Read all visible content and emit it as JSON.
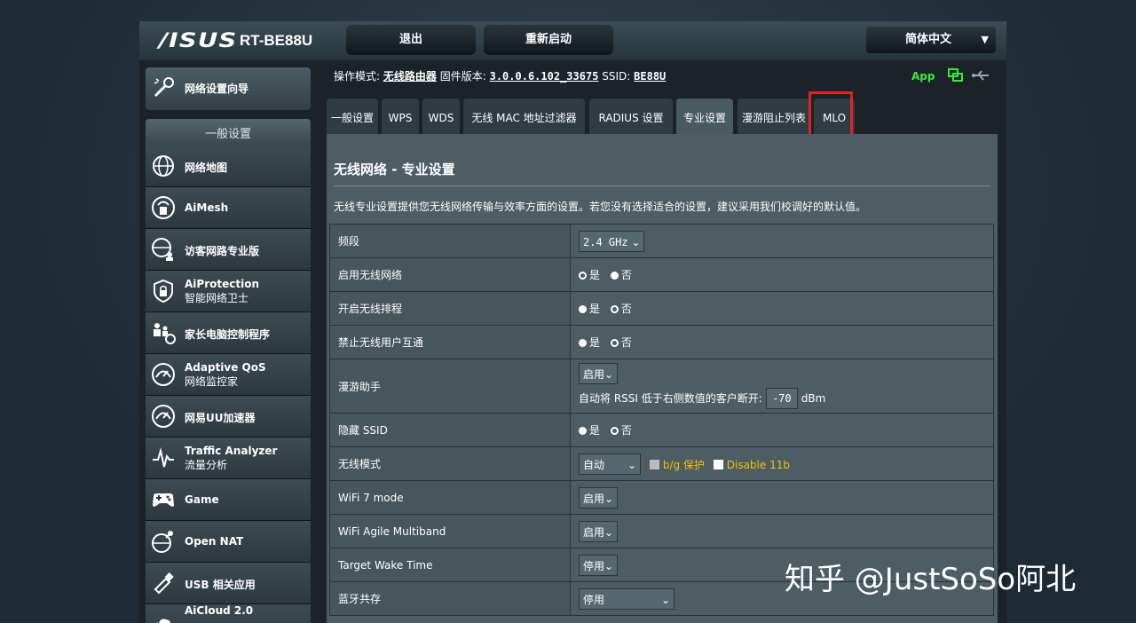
{
  "header": {
    "logo": "/ISUS",
    "model": "RT-BE88U",
    "logout_label": "退出",
    "reboot_label": "重新启动",
    "language": "简体中文"
  },
  "sidebar": {
    "wizard": "网络设置向导",
    "section_title": "一般设置",
    "items": [
      {
        "label": "网络地图"
      },
      {
        "label": "AiMesh"
      },
      {
        "label": "访客网路专业版"
      },
      {
        "label": "AiProtection",
        "sub": "智能网络卫士"
      },
      {
        "label": "家长电脑控制程序"
      },
      {
        "label": "Adaptive QoS",
        "sub": "网络监控家"
      },
      {
        "label": "网易UU加速器"
      },
      {
        "label": "Traffic Analyzer",
        "sub": "流量分析"
      },
      {
        "label": "Game"
      },
      {
        "label": "Open NAT"
      },
      {
        "label": "USB 相关应用"
      },
      {
        "label": "AiCloud 2.0"
      }
    ]
  },
  "info": {
    "mode_label": "操作模式:",
    "mode_value": "无线路由器",
    "fw_label": "固件版本:",
    "fw_value": "3.0.0.6.102_33675",
    "ssid_label": "SSID:",
    "ssid_value": "BE88U",
    "app_label": "App"
  },
  "tabs": [
    "一般设置",
    "WPS",
    "WDS",
    "无线 MAC 地址过滤器",
    "RADIUS 设置",
    "专业设置",
    "漫游阻止列表",
    "MLO"
  ],
  "page": {
    "title": "无线网络 - 专业设置",
    "description": "无线专业设置提供您无线网络传输与效率方面的设置。若您没有选择适合的设置，建议采用我们校调好的默认值。"
  },
  "settings": {
    "band": {
      "label": "频段",
      "value": "2.4 GHz"
    },
    "enable_radio": {
      "label": "启用无线网络",
      "yes": "是",
      "no": "否"
    },
    "wireless_schedule": {
      "label": "开启无线排程",
      "yes": "是",
      "no": "否"
    },
    "ap_isolation": {
      "label": "禁止无线用户互通",
      "yes": "是",
      "no": "否"
    },
    "roaming": {
      "label": "漫游助手",
      "value": "启用",
      "rssi_text": "自动将 RSSI 低于右侧数值的客户断开:",
      "rssi_value": "-70",
      "unit": "dBm"
    },
    "hide_ssid": {
      "label": "隐藏 SSID",
      "yes": "是",
      "no": "否"
    },
    "wireless_mode": {
      "label": "无线模式",
      "value": "自动",
      "bg_protect": "b/g 保护",
      "disable_11b": "Disable 11b"
    },
    "wifi7": {
      "label": "WiFi 7 mode",
      "value": "启用"
    },
    "agile": {
      "label": "WiFi Agile Multiband",
      "value": "启用"
    },
    "twt": {
      "label": "Target Wake Time",
      "value": "停用"
    },
    "bt_coex": {
      "label": "蓝牙共存",
      "value": "停用"
    }
  },
  "watermark": "知乎 @JustSoSo阿北",
  "colors": {
    "accent_yellow": "#f2c200",
    "highlight_red": "#e52222",
    "green_icon": "#33ee33"
  }
}
